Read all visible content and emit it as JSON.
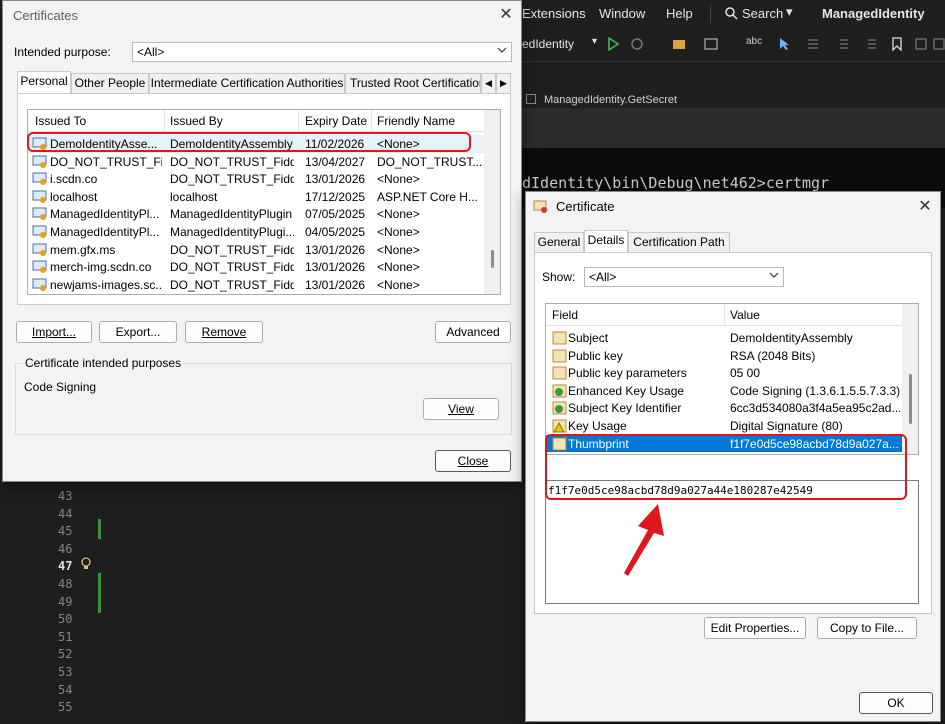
{
  "vs": {
    "menu": [
      "Extensions",
      "Window",
      "Help",
      "Search",
      "ManagedIdentity"
    ],
    "toolbar_project": "edIdentity",
    "tab_fragment": "ManagedIdentity.GetSecret",
    "console_line": "dIdentity\\bin\\Debug\\net462>certmgr",
    "line_numbers": [
      "43",
      "44",
      "45",
      "46",
      "47",
      "48",
      "49",
      "50",
      "51",
      "52",
      "53",
      "54",
      "55"
    ],
    "active_line": "47"
  },
  "certmgr": {
    "title": "Certificates",
    "intended_purpose_label": "Intended purpose:",
    "intended_purpose_value": "<All>",
    "tabs": [
      "Personal",
      "Other People",
      "Intermediate Certification Authorities",
      "Trusted Root Certification"
    ],
    "columns": [
      "Issued To",
      "Issued By",
      "Expiry Date",
      "Friendly Name"
    ],
    "rows": [
      {
        "issued_to": "DemoIdentityAsse...",
        "issued_by": "DemoIdentityAssembly",
        "expiry": "11/02/2026",
        "friendly": "<None>"
      },
      {
        "issued_to": "DO_NOT_TRUST_Fi...",
        "issued_by": "DO_NOT_TRUST_Fidd...",
        "expiry": "13/04/2027",
        "friendly": "DO_NOT_TRUST..."
      },
      {
        "issued_to": "i.scdn.co",
        "issued_by": "DO_NOT_TRUST_Fidd...",
        "expiry": "13/01/2026",
        "friendly": "<None>"
      },
      {
        "issued_to": "localhost",
        "issued_by": "localhost",
        "expiry": "17/12/2025",
        "friendly": "ASP.NET Core H..."
      },
      {
        "issued_to": "ManagedIdentityPl...",
        "issued_by": "ManagedIdentityPlugin",
        "expiry": "07/05/2025",
        "friendly": "<None>"
      },
      {
        "issued_to": "ManagedIdentityPl...",
        "issued_by": "ManagedIdentityPlugi...",
        "expiry": "04/05/2025",
        "friendly": "<None>"
      },
      {
        "issued_to": "mem.gfx.ms",
        "issued_by": "DO_NOT_TRUST_Fidd...",
        "expiry": "13/01/2026",
        "friendly": "<None>"
      },
      {
        "issued_to": "merch-img.scdn.co",
        "issued_by": "DO_NOT_TRUST_Fidd...",
        "expiry": "13/01/2026",
        "friendly": "<None>"
      },
      {
        "issued_to": "newjams-images.sc...",
        "issued_by": "DO_NOT_TRUST_Fidd...",
        "expiry": "13/01/2026",
        "friendly": "<None>"
      }
    ],
    "buttons": {
      "import": "Import...",
      "export": "Export...",
      "remove": "Remove",
      "advanced": "Advanced",
      "view": "View",
      "close": "Close"
    },
    "purposes_group_label": "Certificate intended purposes",
    "purposes_value": "Code Signing"
  },
  "certificate": {
    "title": "Certificate",
    "tabs": [
      "General",
      "Details",
      "Certification Path"
    ],
    "show_label": "Show:",
    "show_value": "<All>",
    "columns": [
      "Field",
      "Value"
    ],
    "rows": [
      {
        "field": "Subject",
        "value": "DemoIdentityAssembly",
        "icon": "field-doc-icon"
      },
      {
        "field": "Public key",
        "value": "RSA (2048 Bits)",
        "icon": "field-doc-icon"
      },
      {
        "field": "Public key parameters",
        "value": "05 00",
        "icon": "field-doc-icon"
      },
      {
        "field": "Enhanced Key Usage",
        "value": "Code Signing (1.3.6.1.5.5.7.3.3)",
        "icon": "extension-green-icon"
      },
      {
        "field": "Subject Key Identifier",
        "value": "6cc3d534080a3f4a5ea95c2ad...",
        "icon": "extension-green-icon"
      },
      {
        "field": "Key Usage",
        "value": "Digital Signature (80)",
        "icon": "warning-icon"
      },
      {
        "field": "Thumbprint",
        "value": "f1f7e0d5ce98acbd78d9a027a...",
        "icon": "field-doc-icon"
      }
    ],
    "selected_row": 6,
    "detail_text": "f1f7e0d5ce98acbd78d9a027a44e180287e42549",
    "buttons": {
      "edit_properties": "Edit Properties...",
      "copy_to_file": "Copy to File...",
      "ok": "OK"
    }
  },
  "colors": {
    "selection": "#0078d7",
    "highlight": "#e0161f",
    "listview_selected": "#e5f1fb"
  }
}
